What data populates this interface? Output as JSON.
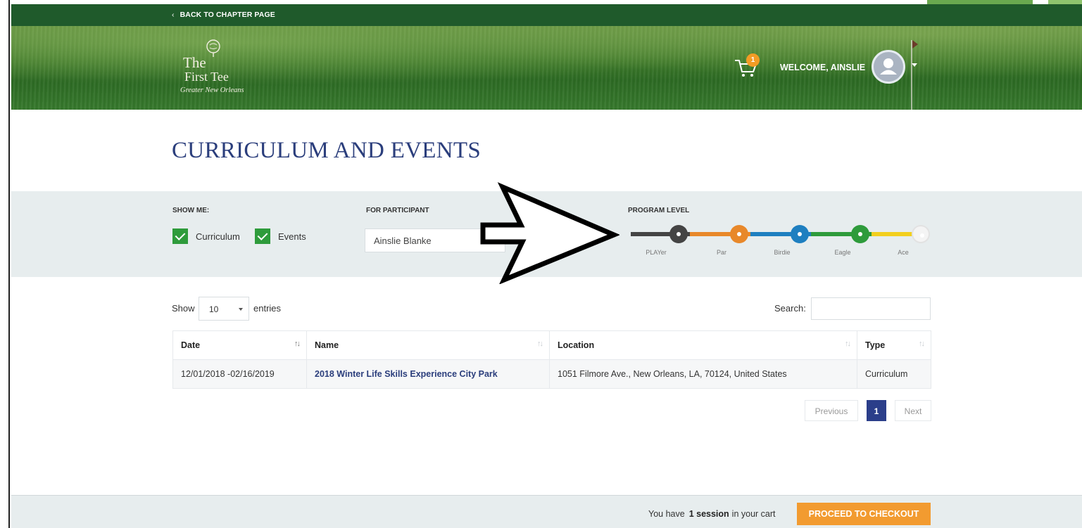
{
  "topbar": {
    "back_label": "BACK TO CHAPTER PAGE"
  },
  "header": {
    "logo": {
      "line1": "The",
      "line2": "First Tee",
      "line3": "Greater New Orleans"
    },
    "cart_count": "1",
    "welcome": "WELCOME, AINSLIE"
  },
  "page": {
    "title": "CURRICULUM AND EVENTS"
  },
  "filters": {
    "show_me_label": "SHOW ME:",
    "curriculum_label": "Curriculum",
    "events_label": "Events",
    "curriculum_checked": true,
    "events_checked": true,
    "participant_label": "FOR PARTICIPANT",
    "participant_value": "Ainslie Blanke",
    "program_level_label": "PROGRAM LEVEL",
    "levels": [
      {
        "name": "PLAYer",
        "color": "#444444"
      },
      {
        "name": "Par",
        "color": "#e8882a"
      },
      {
        "name": "Birdie",
        "color": "#1e7fc0"
      },
      {
        "name": "Eagle",
        "color": "#2e9b3b"
      },
      {
        "name": "Ace",
        "color": "#f2cf1e"
      }
    ]
  },
  "table_controls": {
    "show_label": "Show",
    "entries_value": "10",
    "entries_label": "entries",
    "search_label": "Search:",
    "search_value": ""
  },
  "table": {
    "columns": [
      "Date",
      "Name",
      "Location",
      "Type"
    ],
    "rows": [
      {
        "date": "12/01/2018 -02/16/2019",
        "name": "2018 Winter Life Skills Experience City Park",
        "location": "1051 Filmore Ave., New Orleans, LA, 70124, United States",
        "type": "Curriculum"
      }
    ]
  },
  "pagination": {
    "previous": "Previous",
    "current": "1",
    "next": "Next"
  },
  "footer": {
    "cart_prefix": "You have",
    "cart_count": "1 session",
    "cart_suffix": "in your cart",
    "checkout_label": "PROCEED TO CHECKOUT"
  },
  "colors": {
    "topbar": "#1f5a2b",
    "title": "#2b3e7c",
    "checkbox": "#2e9b3b",
    "cart_badge": "#f39c25",
    "checkout": "#f29b30",
    "active_page": "#2b3e8a"
  }
}
